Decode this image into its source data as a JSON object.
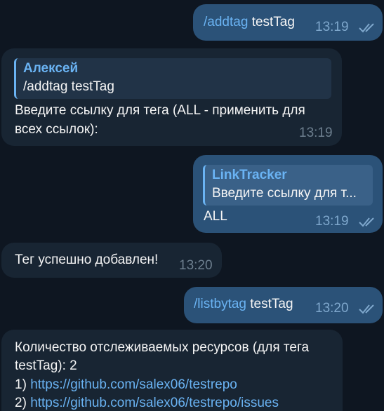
{
  "colors": {
    "background": "#0e1621",
    "outgoing_bubble": "#2b5278",
    "incoming_bubble": "#182533",
    "accent": "#6ab3f3"
  },
  "messages": [
    {
      "command": "/addtag",
      "arg": "testTag",
      "time": "13:19",
      "read_icon": "double-check-icon"
    },
    {
      "reply_author": "Алексей",
      "reply_text": "/addtag testTag",
      "text_line1": "Введите ссылку для тега (ALL - применить для",
      "text_line2": "всех ссылок):",
      "time": "13:19"
    },
    {
      "reply_author": "LinkTracker",
      "reply_text": "Введите ссылку для т...",
      "text": "ALL",
      "time": "13:19",
      "read_icon": "double-check-icon"
    },
    {
      "text": "Тег успешно добавлен!",
      "time": "13:20"
    },
    {
      "command": "/listbytag",
      "arg": "testTag",
      "time": "13:20",
      "read_icon": "double-check-icon"
    },
    {
      "line1": "Количество отслеживаемых ресурсов (для тега",
      "line2": "testTag): 2",
      "item1_prefix": "1)",
      "item1_link": "https://github.com/salex06/testrepo",
      "item2_prefix": "2)",
      "item2_link": "https://github.com/salex06/testrepo/issues"
    }
  ]
}
